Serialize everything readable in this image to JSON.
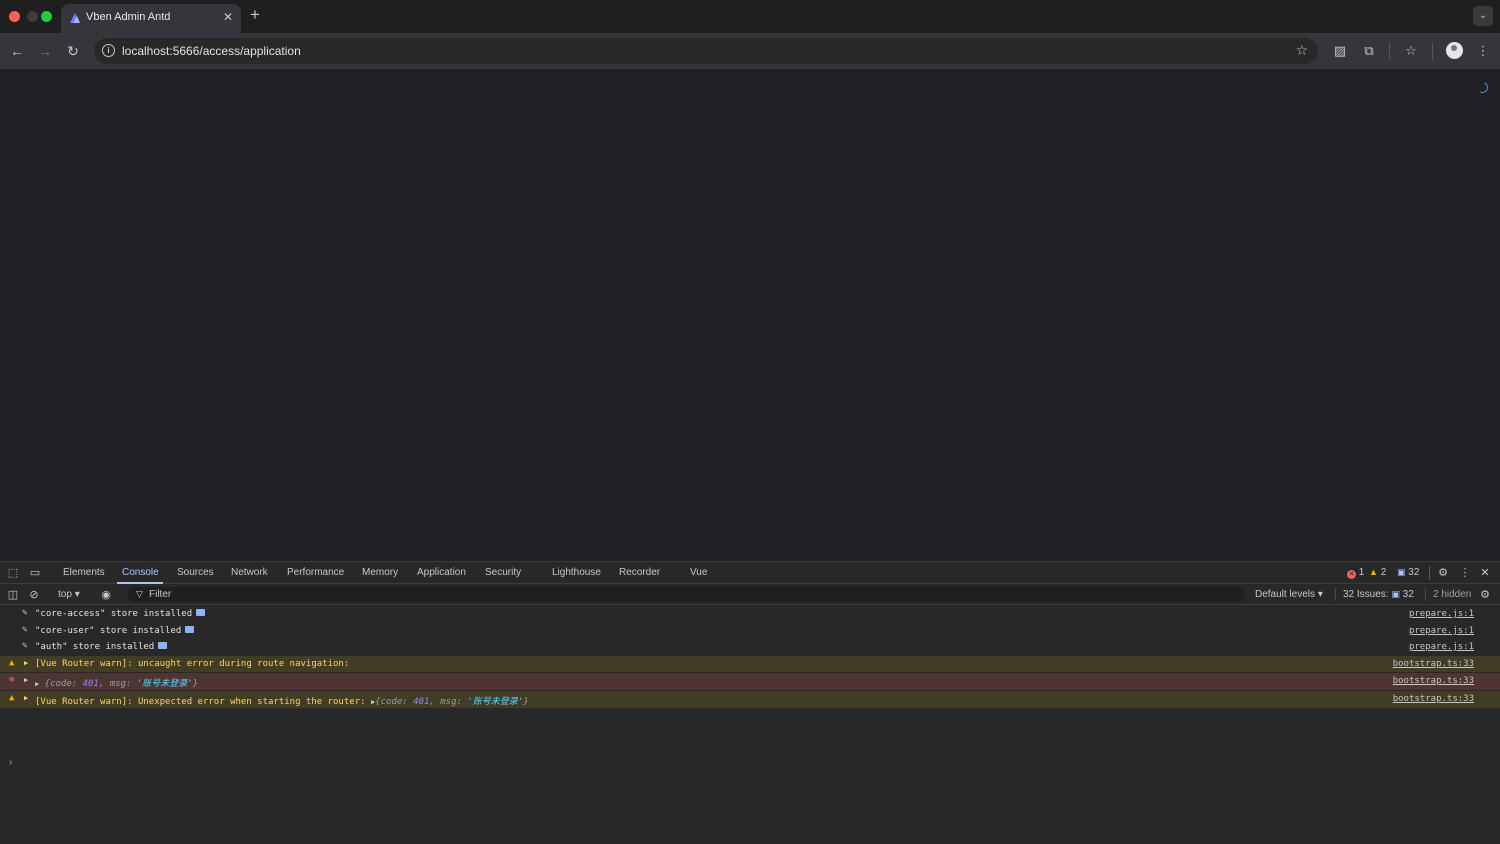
{
  "browser": {
    "tab_title": "Vben Admin Antd",
    "url": "localhost:5666/access/application",
    "page_load_progress": 0.79
  },
  "devtools": {
    "tabs": [
      "Elements",
      "Console",
      "Sources",
      "Network",
      "Performance",
      "Memory",
      "Application",
      "Security",
      "Lighthouse",
      "Recorder",
      "Vue"
    ],
    "active_tab": "Console",
    "counts": {
      "errors": "1",
      "warnings": "2",
      "messages": "32"
    },
    "filterbar": {
      "context": "top",
      "filter_placeholder": "Filter",
      "levels": "Default levels",
      "issues_label": "32 Issues:",
      "issues_count": "32",
      "hidden": "2 hidden"
    },
    "console": [
      {
        "level": "log",
        "text": "\"core-access\" store installed",
        "source": "prepare.js:1"
      },
      {
        "level": "log",
        "text": "\"core-user\" store installed",
        "source": "prepare.js:1"
      },
      {
        "level": "log",
        "text": "\"auth\" store installed",
        "source": "prepare.js:1"
      },
      {
        "level": "warn",
        "text": "[Vue Router warn]: uncaught error during route navigation:",
        "source": "bootstrap.ts:33"
      },
      {
        "level": "error",
        "obj_prefix": "{",
        "code_key": "code",
        "code_val": "401",
        "msg_key": "msg",
        "msg_val": "'账号未登录'",
        "obj_suffix": "}",
        "source": "bootstrap.ts:33"
      },
      {
        "level": "warn",
        "text": "[Vue Router warn]: Unexpected error when starting the router:",
        "code_key": "code",
        "code_val": "401",
        "msg_key": "msg",
        "msg_val": "'账号未登录'",
        "source": "bootstrap.ts:33"
      }
    ]
  }
}
